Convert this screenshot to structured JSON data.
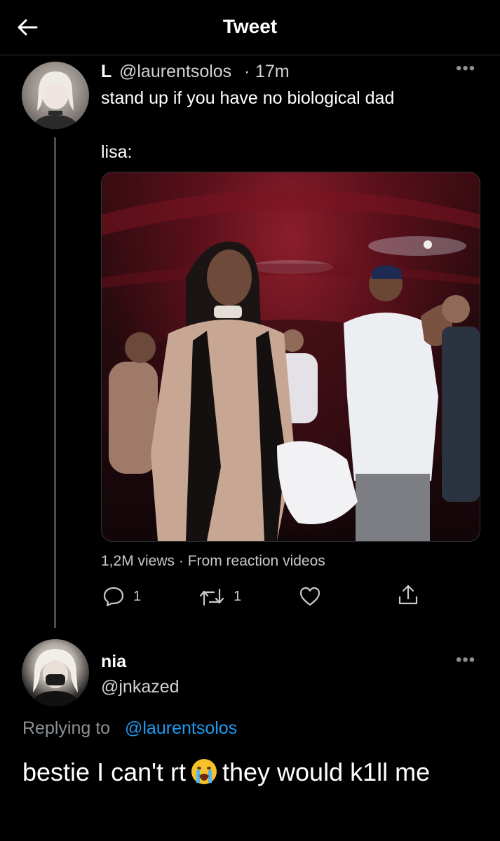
{
  "header": {
    "title": "Tweet"
  },
  "tweet": {
    "author_name": "L",
    "author_handle": "@laurentsolos",
    "separator": "·",
    "time": "17m",
    "text_line1": "stand up if you have no biological dad",
    "text_line2": "lisa:",
    "media_meta": "1,2M views · From reaction videos",
    "actions": {
      "reply_count": "1",
      "retweet_count": "1"
    }
  },
  "reply": {
    "author_name": "nia",
    "author_handle": "@jnkazed",
    "replying_label": "Replying to",
    "replying_user": "@laurentsolos",
    "text_before_emoji": "bestie I can't rt",
    "emoji": "crying-face",
    "text_after_emoji": "they would k1ll me"
  },
  "icons": [
    "back-arrow-icon",
    "more-icon",
    "reply-icon",
    "retweet-icon",
    "like-icon",
    "share-icon"
  ],
  "colors": {
    "background": "#000000",
    "text": "#e7e9ea",
    "secondary": "#8b9196",
    "link": "#1d9bf0"
  }
}
